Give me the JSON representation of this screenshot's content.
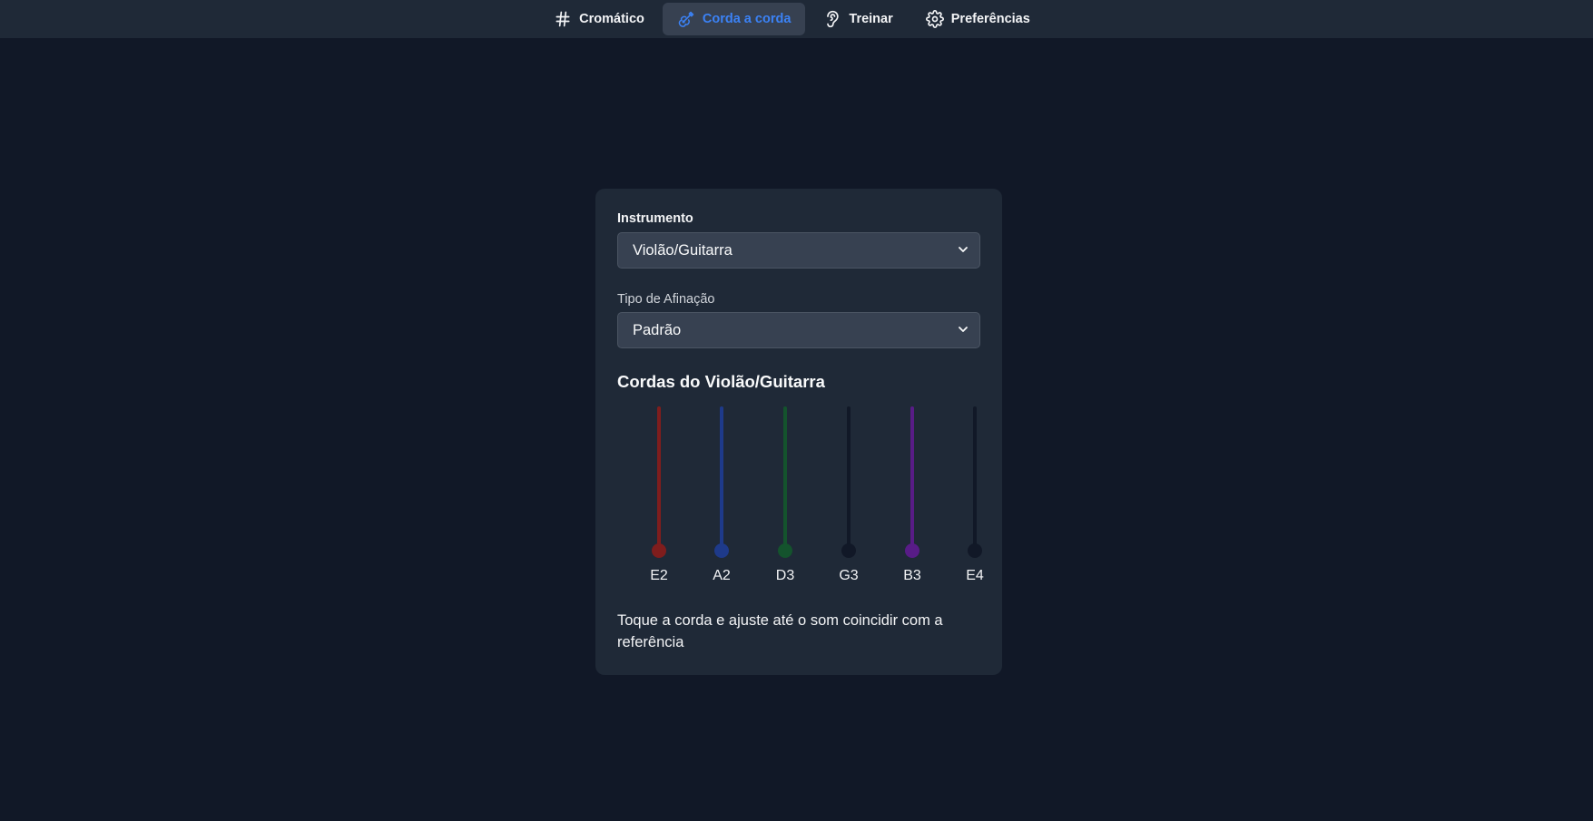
{
  "nav": {
    "items": [
      {
        "label": "Cromático",
        "icon": "hash-icon",
        "active": false
      },
      {
        "label": "Corda a corda",
        "icon": "guitar-icon",
        "active": true
      },
      {
        "label": "Treinar",
        "icon": "ear-icon",
        "active": false
      },
      {
        "label": "Preferências",
        "icon": "gear-icon",
        "active": false
      }
    ]
  },
  "form": {
    "instrument_label": "Instrumento",
    "instrument_value": "Violão/Guitarra",
    "tuning_label": "Tipo de Afinação",
    "tuning_value": "Padrão"
  },
  "strings": {
    "title": "Cordas do Violão/Guitarra",
    "items": [
      {
        "note": "E2",
        "color": "#7f1d1d"
      },
      {
        "note": "A2",
        "color": "#1e3a8a"
      },
      {
        "note": "D3",
        "color": "#14532d"
      },
      {
        "note": "G3",
        "color": "#111827"
      },
      {
        "note": "B3",
        "color": "#581c87"
      },
      {
        "note": "E4",
        "color": "#111827"
      }
    ]
  },
  "hint": "Toque a corda e ajuste até o som coincidir com a referência",
  "colors": {
    "background": "#111827",
    "surface": "#1f2937",
    "accent": "#3b82f6"
  }
}
